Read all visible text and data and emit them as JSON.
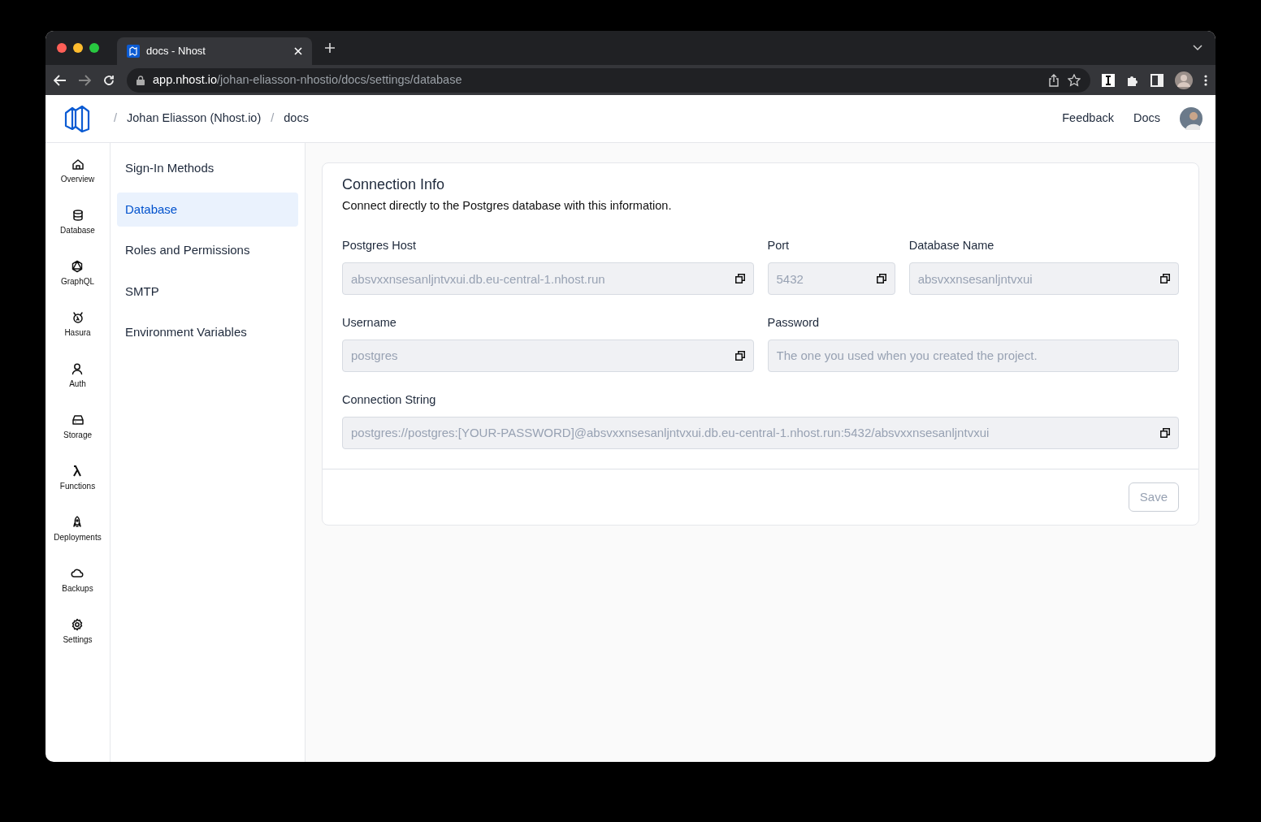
{
  "browser": {
    "tab_title": "docs - Nhost",
    "url_host": "app.nhost.io",
    "url_path": "/johan-eliasson-nhostio/docs/settings/database"
  },
  "header": {
    "separator": "/",
    "breadcrumbs": [
      "Johan Eliasson (Nhost.io)",
      "docs"
    ],
    "links": [
      "Feedback",
      "Docs"
    ]
  },
  "nav": [
    {
      "label": "Overview",
      "kind": "home",
      "selected": false
    },
    {
      "label": "Database",
      "kind": "database",
      "selected": false
    },
    {
      "label": "GraphQL",
      "kind": "graphql",
      "selected": false
    },
    {
      "label": "Hasura",
      "kind": "hasura",
      "selected": false
    },
    {
      "label": "Auth",
      "kind": "user",
      "selected": false
    },
    {
      "label": "Storage",
      "kind": "storage",
      "selected": false
    },
    {
      "label": "Functions",
      "kind": "lambda",
      "selected": false
    },
    {
      "label": "Deployments",
      "kind": "rocket",
      "selected": false
    },
    {
      "label": "Backups",
      "kind": "cloud",
      "selected": false
    },
    {
      "label": "Settings",
      "kind": "gear",
      "selected": false
    }
  ],
  "settings_menu": [
    {
      "label": "Sign-In Methods",
      "selected": false
    },
    {
      "label": "Database",
      "selected": true
    },
    {
      "label": "Roles and Permissions",
      "selected": false
    },
    {
      "label": "SMTP",
      "selected": false
    },
    {
      "label": "Environment Variables",
      "selected": false
    }
  ],
  "card": {
    "title": "Connection Info",
    "description": "Connect directly to the Postgres database with this information.",
    "field_rows": [
      [
        {
          "label": "Postgres Host",
          "value": "absvxxnsesanljntvxui.db.eu-central-1.nhost.run",
          "copyable": true
        },
        {
          "label": "Port",
          "value": "5432",
          "copyable": true
        },
        {
          "label": "Database Name",
          "value": "absvxxnsesanljntvxui",
          "copyable": true
        }
      ],
      [
        {
          "label": "Username",
          "value": "postgres",
          "copyable": true
        },
        {
          "label": "Password",
          "placeholder": "The one you used when you created the project.",
          "copyable": false
        }
      ],
      [
        {
          "label": "Connection String",
          "value": "postgres://postgres:[YOUR-PASSWORD]@absvxxnsesanljntvxui.db.eu-central-1.nhost.run:5432/absvxxnsesanljntvxui",
          "copyable": true
        }
      ]
    ],
    "save_button": {
      "label": "Save",
      "disabled": true
    }
  }
}
